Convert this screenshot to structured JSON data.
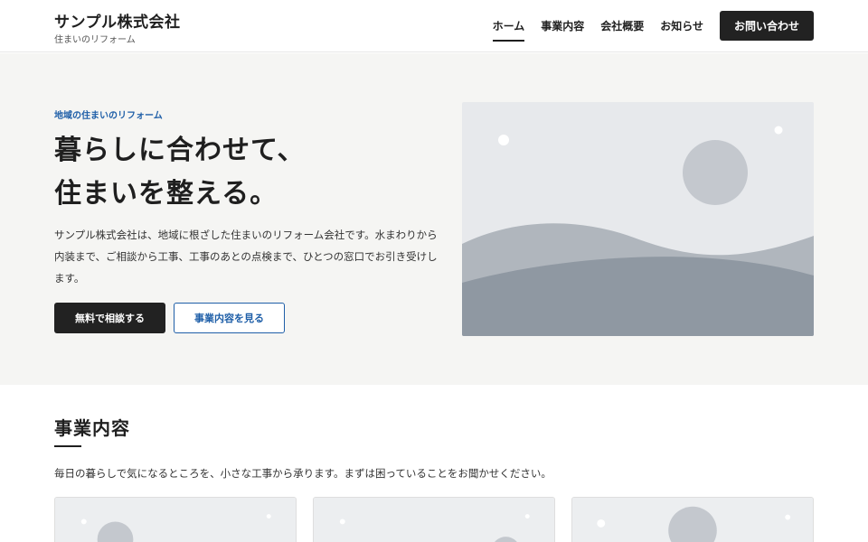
{
  "header": {
    "brand_name": "サンプル株式会社",
    "brand_tagline": "住まいのリフォーム",
    "nav": [
      {
        "label": "ホーム",
        "active": true
      },
      {
        "label": "事業内容",
        "active": false
      },
      {
        "label": "会社概要",
        "active": false
      },
      {
        "label": "お知らせ",
        "active": false
      }
    ],
    "contact_label": "お問い合わせ"
  },
  "hero": {
    "eyebrow": "地域の住まいのリフォーム",
    "title_line1": "暮らしに合わせて、",
    "title_line2": "住まいを整える。",
    "text": "サンプル株式会社は、地域に根ざした住まいのリフォーム会社です。水まわりから内装まで、ご相談から工事、工事のあとの点検まで、ひとつの窓口でお引き受けします。",
    "primary_button": "無料で相談する",
    "secondary_button": "事業内容を見る",
    "image_icon": "landscape-placeholder-icon"
  },
  "services": {
    "title": "事業内容",
    "lead": "毎日の暮らしで気になるところを、小さな工事から承ります。まずは困っていることをお聞かせください。",
    "cards": [
      {
        "image_icon": "landscape-placeholder-icon"
      },
      {
        "image_icon": "landscape-placeholder-icon"
      },
      {
        "image_icon": "landscape-placeholder-icon"
      }
    ]
  },
  "colors": {
    "accent": "#1f5fa8",
    "dark": "#222222",
    "hero_bg": "#f5f5f3"
  }
}
